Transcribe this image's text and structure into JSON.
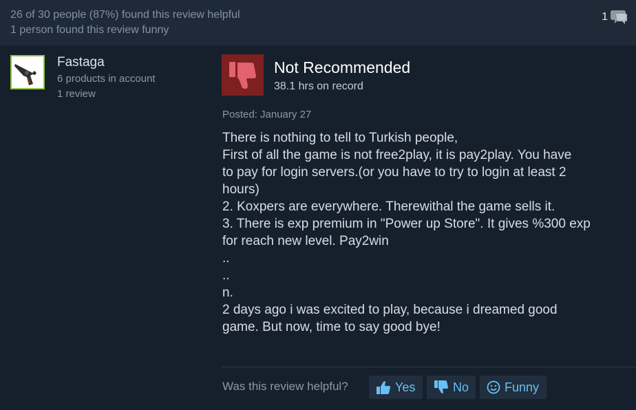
{
  "header": {
    "helpful_text": "26 of 30 people (87%) found this review helpful",
    "funny_text": "1 person found this review funny",
    "comment_count": "1",
    "comment_icon": "speech-bubble-icon"
  },
  "author": {
    "name": "Fastaga",
    "products": "6 products in account",
    "reviews": "1 review",
    "avatar_icon": "revolver-avatar",
    "avatar_border_color": "#8bc53f"
  },
  "review": {
    "verdict": "Not Recommended",
    "verdict_icon": "thumbs-down-icon",
    "verdict_color": "#7d2020",
    "hours": "38.1 hrs on record",
    "posted": "Posted: January 27",
    "lines": [
      "There is nothing to tell to Turkish people,",
      "First of all the game is not free2play, it is pay2play. You have",
      "to pay for login servers.(or you have to try to login at least 2",
      "hours)",
      "2. Koxpers are everywhere. Therewithal the game sells it.",
      "3. There is exp premium in \"Power up Store\". It gives %300 exp",
      "for reach new level. Pay2win",
      "..",
      "..",
      "n.",
      "2 days ago i was excited to play, because i dreamed good",
      "game. But now, time to say good bye!"
    ]
  },
  "feedback": {
    "question": "Was this review helpful?",
    "yes": "Yes",
    "no": "No",
    "funny": "Funny",
    "accent_color": "#66c0f4"
  }
}
